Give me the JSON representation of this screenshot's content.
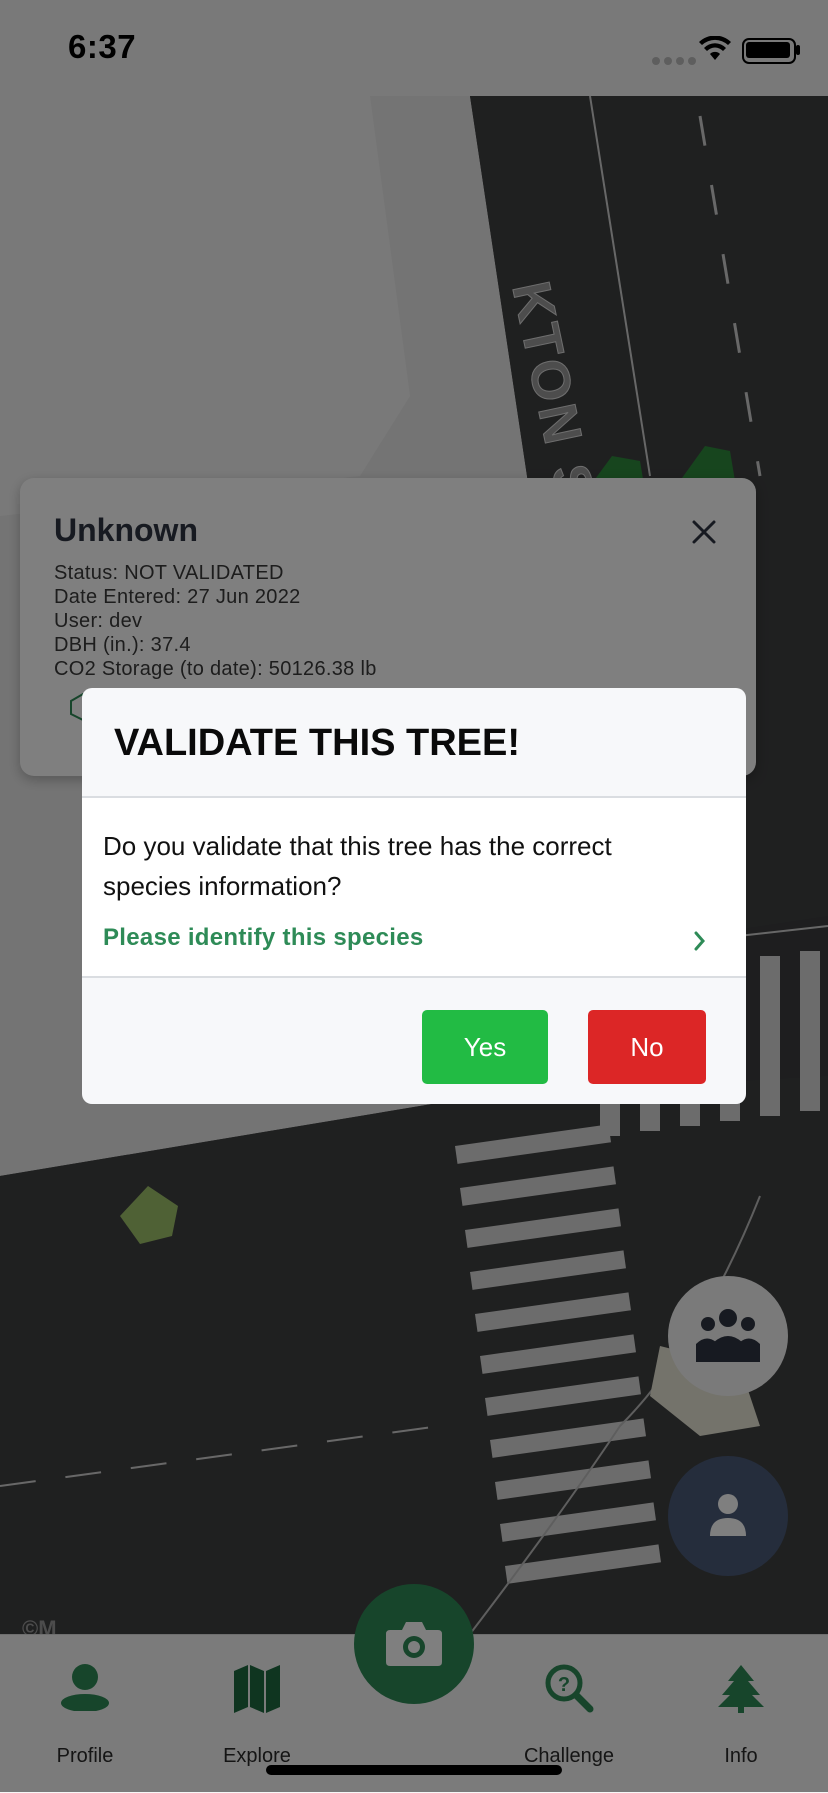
{
  "status_bar": {
    "time": "6:37"
  },
  "map": {
    "street_label": "KTON ST",
    "attribution": "©M"
  },
  "info_card": {
    "title": "Unknown",
    "status": "Status: NOT VALIDATED",
    "date_entered": "Date Entered: 27 Jun 2022",
    "user": "User: dev",
    "dbh": "DBH (in.): 37.4",
    "co2": "CO2 Storage (to date): 50126.38 lb"
  },
  "modal": {
    "title": "VALIDATE THIS TREE!",
    "question": "Do you validate that this tree has the correct species information?",
    "identify_link": "Please identify this species",
    "yes_label": "Yes",
    "no_label": "No"
  },
  "nav": {
    "items": [
      {
        "label": "Profile",
        "icon": "profile-icon"
      },
      {
        "label": "Explore",
        "icon": "map-icon"
      },
      {
        "label": "Challenge",
        "icon": "challenge-icon"
      },
      {
        "label": "Info",
        "icon": "tree-icon"
      }
    ]
  },
  "colors": {
    "accent_green": "#2e8b57",
    "yes_green": "#22bb44",
    "no_red": "#dc2626",
    "map_dark": "#3c3d3e"
  }
}
